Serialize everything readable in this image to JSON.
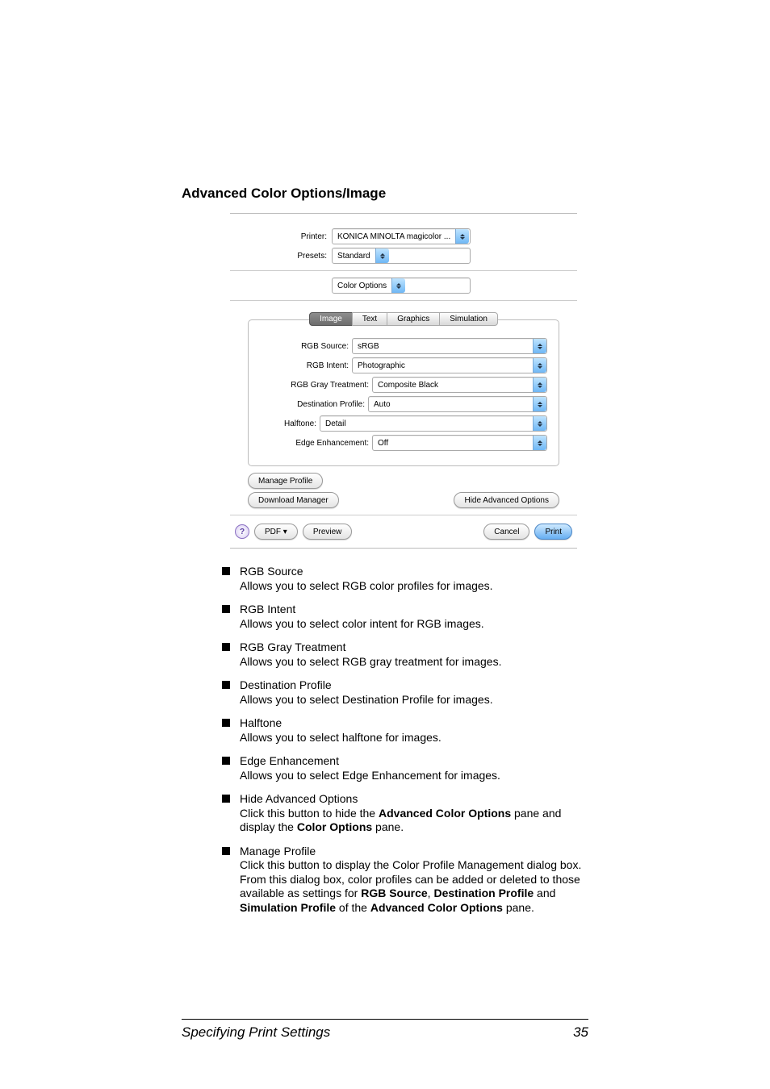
{
  "heading": "Advanced Color Options/Image",
  "dialog": {
    "printer_label": "Printer:",
    "printer_value": "KONICA MINOLTA magicolor ...",
    "presets_label": "Presets:",
    "presets_value": "Standard",
    "section_value": "Color Options",
    "tabs": {
      "image": "Image",
      "text": "Text",
      "graphics": "Graphics",
      "simulation": "Simulation"
    },
    "rgb_source_label": "RGB Source:",
    "rgb_source_value": "sRGB",
    "rgb_intent_label": "RGB Intent:",
    "rgb_intent_value": "Photographic",
    "rgb_gray_label": "RGB Gray Treatment:",
    "rgb_gray_value": "Composite Black",
    "dest_profile_label": "Destination Profile:",
    "dest_profile_value": "Auto",
    "halftone_label": "Halftone:",
    "halftone_value": "Detail",
    "edge_label": "Edge Enhancement:",
    "edge_value": "Off",
    "manage_profile": "Manage Profile",
    "download_manager": "Download Manager",
    "hide_advanced": "Hide Advanced Options",
    "help": "?",
    "pdf": "PDF ▾",
    "preview": "Preview",
    "cancel": "Cancel",
    "print": "Print"
  },
  "bullets": {
    "b0t": "RGB Source",
    "b0d": "Allows you to select RGB color profiles for images.",
    "b1t": "RGB Intent",
    "b1d": "Allows you to select color intent for RGB images.",
    "b2t": "RGB Gray Treatment",
    "b2d": "Allows you to select RGB gray treatment for images.",
    "b3t": "Destination Profile",
    "b3d": "Allows you to select Destination Profile for images.",
    "b4t": "Halftone",
    "b4d": "Allows you to select halftone for images.",
    "b5t": "Edge Enhancement",
    "b5d": "Allows you to select Edge Enhancement for images.",
    "b6t": "Hide Advanced Options",
    "b6d_1": "Click this button to hide the ",
    "b6d_2": "Advanced Color Options",
    "b6d_3": " pane and display the ",
    "b6d_4": "Color Options",
    "b6d_5": " pane.",
    "b7t": "Manage Profile",
    "b7d_1": "Click this button to display the Color Profile Management dialog box. From this dialog box, color profiles can be added or deleted to those available as settings for ",
    "b7d_2": "RGB Source",
    "b7d_3": ", ",
    "b7d_4": "Destination Profile",
    "b7d_5": " and ",
    "b7d_6": "Simulation Profile",
    "b7d_7": " of the ",
    "b7d_8": "Advanced Color Options",
    "b7d_9": " pane."
  },
  "footer": {
    "left": "Specifying Print Settings",
    "right": "35"
  }
}
